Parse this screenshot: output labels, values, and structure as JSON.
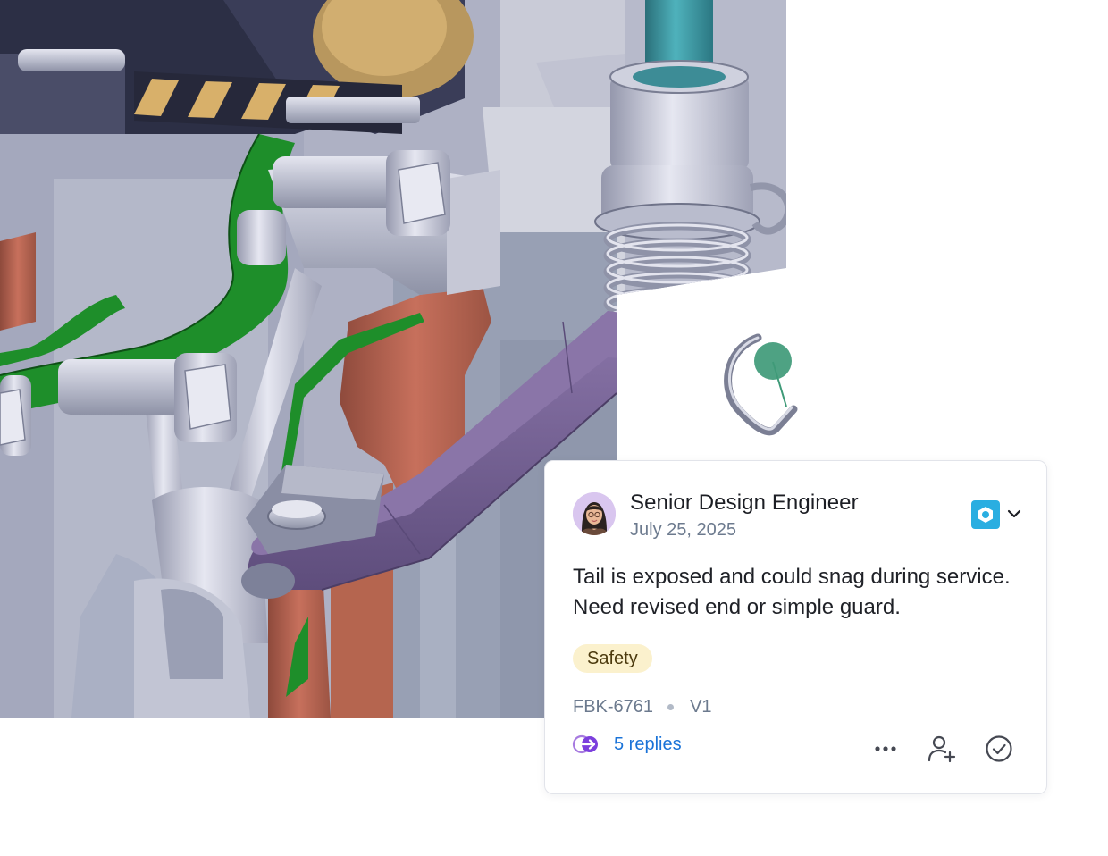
{
  "comment": {
    "author": "Senior Design Engineer",
    "date": "July 25, 2025",
    "body": "Tail is exposed and could snag during service. Need revised end or simple guard.",
    "tag": "Safety",
    "id": "FBK-6761",
    "version": "V1",
    "replies_label": "5 replies"
  },
  "icons": {
    "badge": "camera-view-icon",
    "expand": "chevron-down-icon",
    "replies": "thread-arrow-icon",
    "more": "more-horizontal-icon",
    "assign": "add-user-icon",
    "resolve": "check-circle-icon"
  },
  "colors": {
    "badge": "#2aaee1",
    "link": "#1a73d8",
    "tag_bg": "#fbf1cd",
    "marker": "#3f9a78",
    "arm": "#6e5a8e"
  }
}
